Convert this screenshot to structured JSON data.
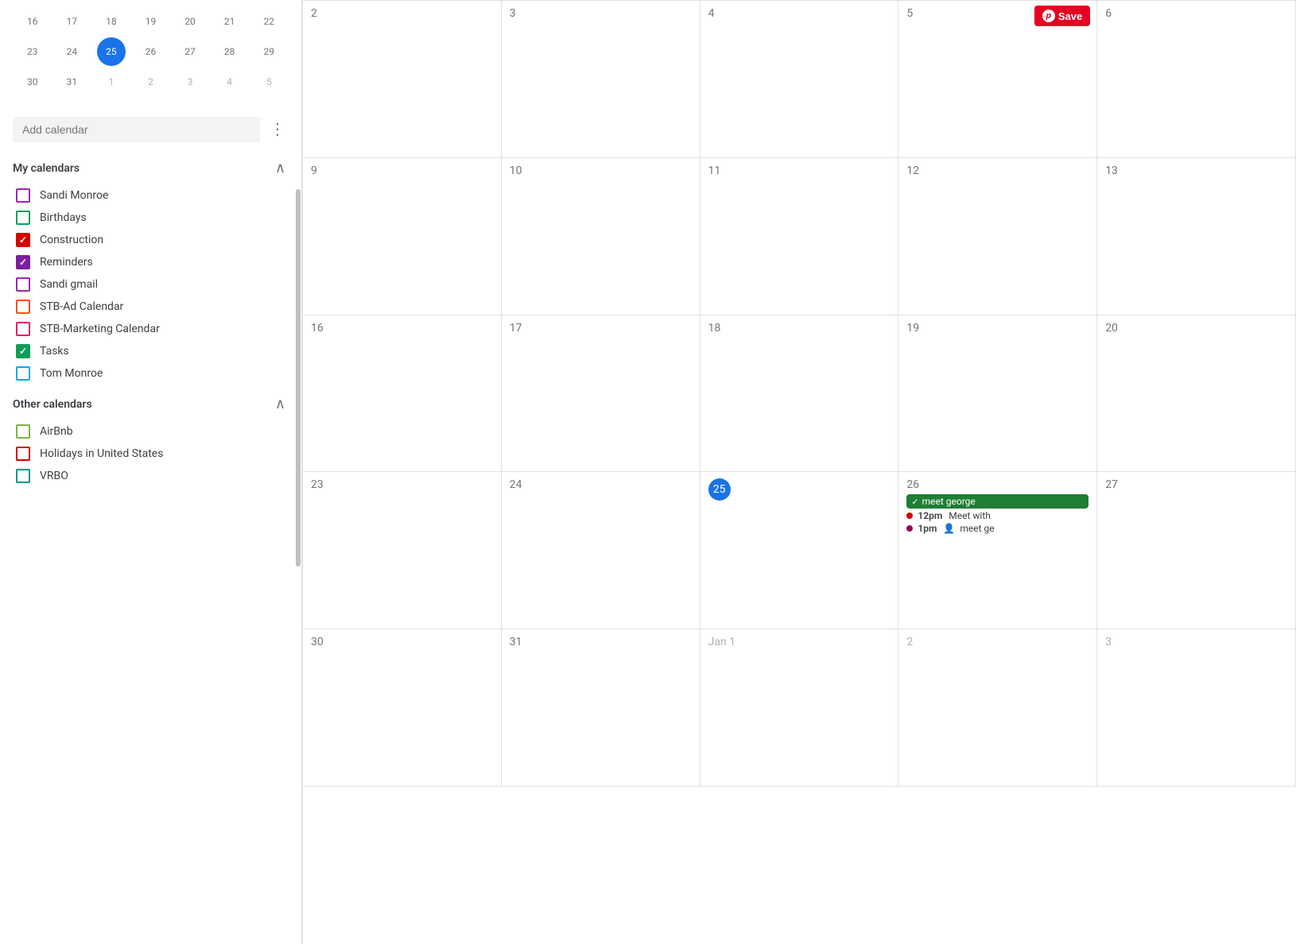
{
  "sidebar": {
    "mini_calendar": {
      "rows": [
        [
          "16",
          "17",
          "18",
          "19",
          "20",
          "21",
          "22"
        ],
        [
          "23",
          "24",
          "25",
          "26",
          "27",
          "28",
          "29"
        ],
        [
          "30",
          "31",
          "1",
          "2",
          "3",
          "4",
          "5"
        ]
      ],
      "today": "25",
      "today_row": 1,
      "today_col": 2
    },
    "add_calendar_placeholder": "Add calendar",
    "my_calendars_label": "My calendars",
    "other_calendars_label": "Other calendars",
    "my_calendars": [
      {
        "name": "Sandi Monroe",
        "color": "#9c27b0",
        "checked": false
      },
      {
        "name": "Birthdays",
        "color": "#0f9d58",
        "checked": false
      },
      {
        "name": "Construction",
        "color": "#d50000",
        "checked": true
      },
      {
        "name": "Reminders",
        "color": "#7b1fa2",
        "checked": true
      },
      {
        "name": "Sandi gmail",
        "color": "#9c27b0",
        "checked": false
      },
      {
        "name": "STB-Ad Calendar",
        "color": "#f4511e",
        "checked": false
      },
      {
        "name": "STB-Marketing Calendar",
        "color": "#e91e63",
        "checked": false
      },
      {
        "name": "Tasks",
        "color": "#0f9d58",
        "checked": true
      },
      {
        "name": "Tom Monroe",
        "color": "#03a9f4",
        "checked": false
      }
    ],
    "other_calendars": [
      {
        "name": "AirBnb",
        "color": "#7cb342",
        "checked": false
      },
      {
        "name": "Holidays in United States",
        "color": "#d50000",
        "checked": false
      },
      {
        "name": "VRBO",
        "color": "#009688",
        "checked": false
      }
    ]
  },
  "calendar": {
    "cells": [
      {
        "date": "2",
        "type": "normal",
        "events": []
      },
      {
        "date": "3",
        "type": "normal",
        "events": []
      },
      {
        "date": "4",
        "type": "normal",
        "events": []
      },
      {
        "date": "5",
        "type": "normal",
        "events": [],
        "has_pinterest": true
      },
      {
        "date": "6",
        "type": "normal",
        "events": []
      },
      {
        "date": "9",
        "type": "normal",
        "events": []
      },
      {
        "date": "10",
        "type": "normal",
        "events": []
      },
      {
        "date": "11",
        "type": "normal",
        "events": []
      },
      {
        "date": "12",
        "type": "normal",
        "events": []
      },
      {
        "date": "13",
        "type": "normal",
        "events": []
      },
      {
        "date": "16",
        "type": "normal",
        "events": []
      },
      {
        "date": "17",
        "type": "normal",
        "events": []
      },
      {
        "date": "18",
        "type": "normal",
        "events": []
      },
      {
        "date": "19",
        "type": "normal",
        "events": []
      },
      {
        "date": "20",
        "type": "normal",
        "events": []
      },
      {
        "date": "23",
        "type": "normal",
        "events": []
      },
      {
        "date": "24",
        "type": "normal",
        "events": []
      },
      {
        "date": "25",
        "type": "today",
        "events": []
      },
      {
        "date": "26",
        "type": "normal",
        "events": [
          {
            "type": "chip",
            "color": "green",
            "text": "meet george"
          },
          {
            "type": "dot",
            "dot_color": "red",
            "time": "12pm",
            "text": "Meet with",
            "icon": ""
          },
          {
            "type": "dot",
            "dot_color": "dark-red",
            "time": "1pm",
            "text": "meet ge",
            "icon": "👤"
          }
        ]
      },
      {
        "date": "27",
        "type": "normal",
        "events": []
      },
      {
        "date": "30",
        "type": "normal",
        "events": []
      },
      {
        "date": "31",
        "type": "normal",
        "events": []
      },
      {
        "date": "Jan 1",
        "type": "other-month",
        "events": []
      },
      {
        "date": "2",
        "type": "other-month",
        "events": []
      },
      {
        "date": "3",
        "type": "other-month",
        "events": []
      }
    ],
    "pinterest_save_label": "Save"
  }
}
